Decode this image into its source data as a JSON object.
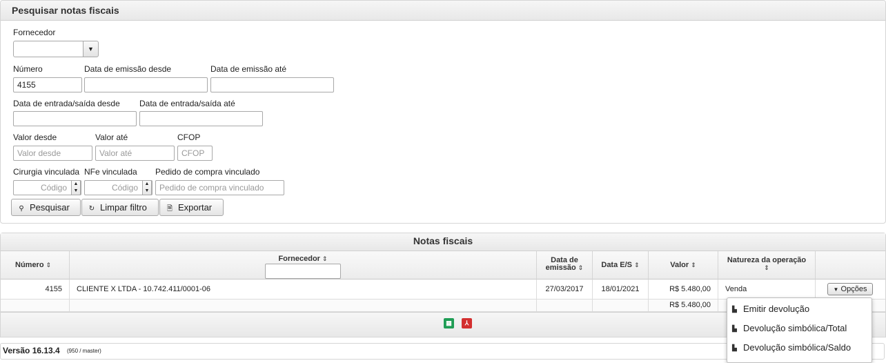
{
  "search": {
    "title": "Pesquisar notas fiscais",
    "fornecedor_label": "Fornecedor",
    "fornecedor_value": "",
    "numero_label": "Número",
    "numero_value": "4155",
    "emissao_desde_label": "Data de emissão desde",
    "emissao_ate_label": "Data de emissão até",
    "es_desde_label": "Data de entrada/saída desde",
    "es_ate_label": "Data de entrada/saída até",
    "valor_desde_label": "Valor desde",
    "valor_desde_placeholder": "Valor desde",
    "valor_ate_label": "Valor até",
    "valor_ate_placeholder": "Valor até",
    "cfop_label": "CFOP",
    "cfop_placeholder": "CFOP",
    "cirurgia_label": "Cirurgia vinculada",
    "cirurgia_placeholder": "Código",
    "nfe_label": "NFe vinculada",
    "nfe_placeholder": "Código",
    "pedido_label": "Pedido de compra vinculado",
    "pedido_placeholder": "Pedido de compra vinculado",
    "btn_pesquisar": "Pesquisar",
    "btn_limpar": "Limpar filtro",
    "btn_exportar": "Exportar"
  },
  "grid": {
    "caption": "Notas fiscais",
    "columns": {
      "numero": "Número",
      "fornecedor": "Fornecedor",
      "emissao_line1": "Data de",
      "emissao_line2": "emissão",
      "data_es": "Data E/S",
      "valor": "Valor",
      "natureza": "Natureza da operação"
    },
    "rows": [
      {
        "numero": "4155",
        "fornecedor": "CLIENTE X LTDA - 10.742.411/0001-06",
        "emissao": "27/03/2017",
        "data_es": "18/01/2021",
        "valor": "R$ 5.480,00",
        "natureza": "Venda"
      }
    ],
    "total_valor": "R$ 5.480,00",
    "options_label": "Opções"
  },
  "menu": {
    "items": [
      "Emitir devolução",
      "Devolução simbólica/Total",
      "Devolução simbólica/Saldo"
    ]
  },
  "footer": {
    "version": "Versão 16.13.4",
    "build": "(950 / master)"
  },
  "colors": {
    "excel_icon": "#1f9d55",
    "pdf_icon": "#d32f2f"
  }
}
